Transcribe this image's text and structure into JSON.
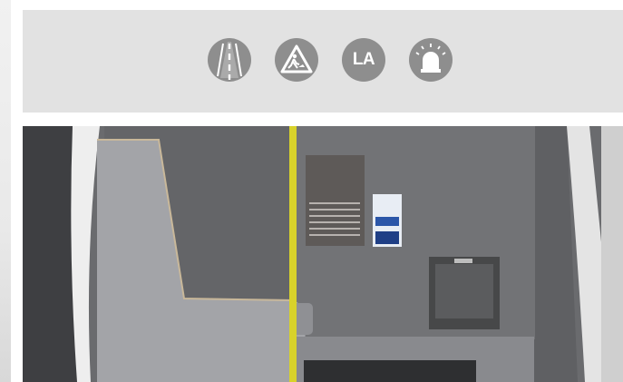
{
  "header": {
    "icons": [
      {
        "name": "road-lane-icon"
      },
      {
        "name": "road-works-icon"
      },
      {
        "name": "la-icon",
        "text": "LA"
      },
      {
        "name": "beacon-light-icon"
      }
    ]
  },
  "photo": {
    "subject": "van-interior-racking"
  },
  "colors": {
    "icon_fill": "#8e8e8e",
    "bar_bg": "#e2e2e2",
    "pole": "#d8d22a"
  }
}
